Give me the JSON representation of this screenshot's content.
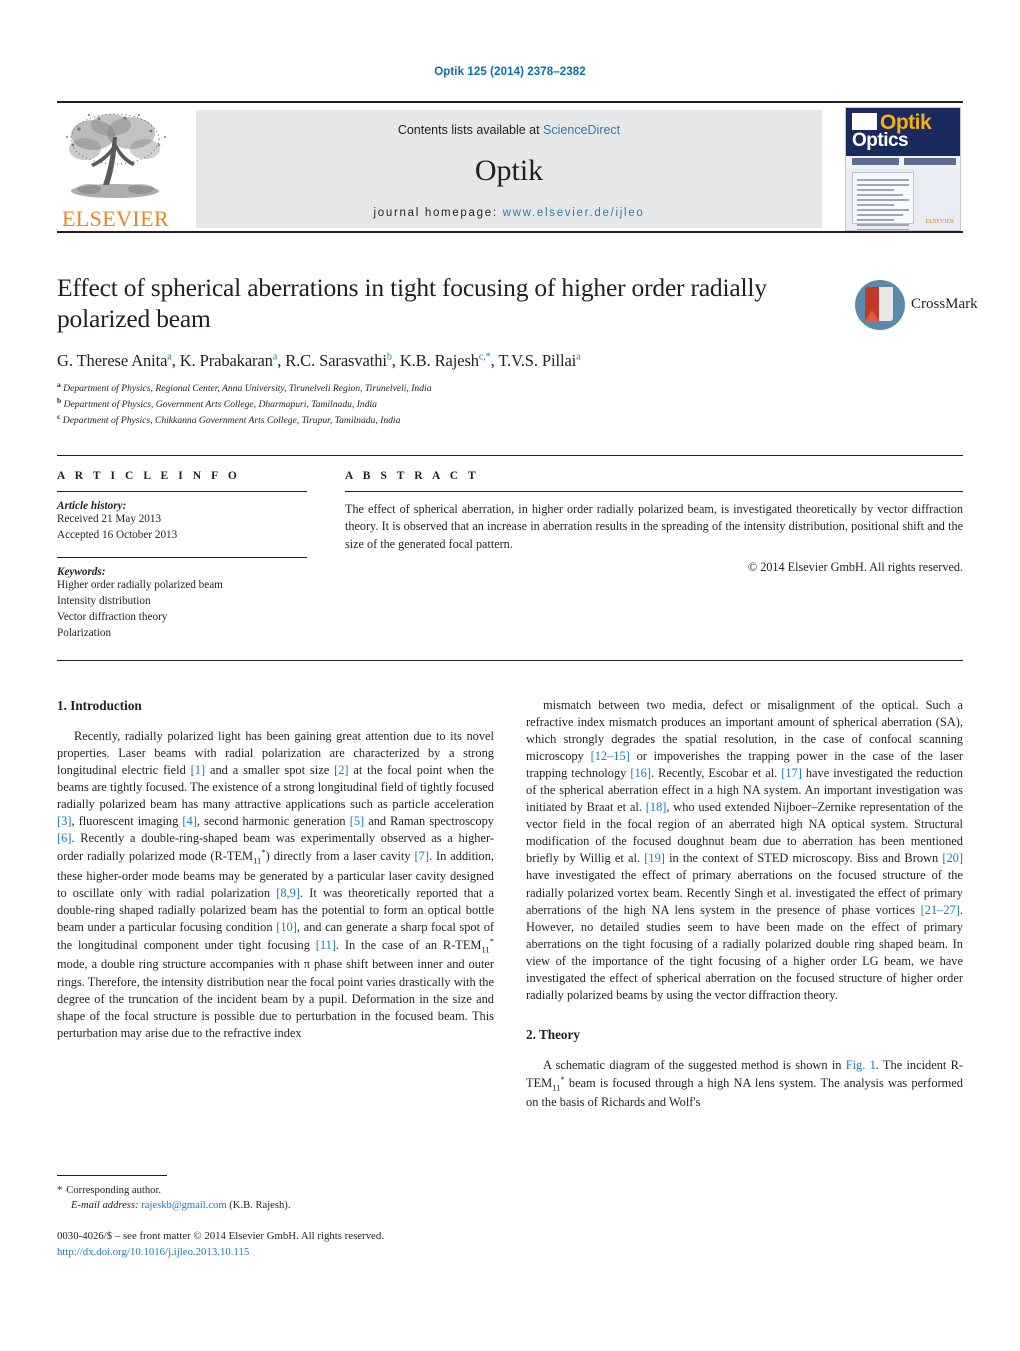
{
  "running_head": "Optik 125 (2014) 2378–2382",
  "masthead": {
    "contents_prefix": "Contents lists available at ",
    "sciencedirect": "ScienceDirect",
    "journal_title": "Optik",
    "homepage_prefix": "journal homepage:",
    "homepage_url": "www.elsevier.de/ijleo",
    "publisher_wordmark": "ELSEVIER",
    "cover": {
      "title_top": "Optik",
      "title_bottom": "Optics",
      "publisher": "ELSEVIER"
    },
    "colors": {
      "link_blue": "#2e7db3",
      "elsevier_orange": "#e8842a",
      "banner_gray": "#e6e7e8",
      "cover_navy": "#1b2a5e",
      "cover_yellow": "#f5b014"
    }
  },
  "article": {
    "title": "Effect of spherical aberrations in tight focusing of higher order radially polarized beam",
    "authors_html": "G. Therese Anita<sup>a</sup>, K. Prabakaran<sup>a</sup>, R.C. Sarasvathi<sup>b</sup>, K.B. Rajesh<sup>c,*</sup>, T.V.S. Pillai<sup>a</sup>",
    "affiliations": [
      {
        "marker": "a",
        "text": "Department of Physics, Regional Center, Anna University, Tirunelveli Region, Tirunelveli, India"
      },
      {
        "marker": "b",
        "text": "Department of Physics, Government Arts College, Dharmapuri, Tamilnadu, India"
      },
      {
        "marker": "c",
        "text": "Department of Physics, Chikkanna Government Arts College, Tirupur, Tamilnadu, India"
      }
    ],
    "crossmark_label": "CrossMark"
  },
  "article_info": {
    "heading": "A R T I C L E    I N F O",
    "history_label": "Article history:",
    "received": "Received 21 May 2013",
    "accepted": "Accepted 16 October 2013",
    "keywords_label": "Keywords:",
    "keywords": [
      "Higher order radially polarized beam",
      "Intensity distribution",
      "Vector diffraction theory",
      "Polarization"
    ]
  },
  "abstract": {
    "heading": "A B S T R A C T",
    "text": "The effect of spherical aberration, in higher order radially polarized beam, is investigated theoretically by vector diffraction theory. It is observed that an increase in aberration results in the spreading of the intensity distribution, positional shift and the size of the generated focal pattern.",
    "copyright": "© 2014 Elsevier GmbH. All rights reserved."
  },
  "body": {
    "intro_heading": "1.  Introduction",
    "intro_html": "Recently, radially polarized light has been gaining great attention due to its novel properties. Laser beams with radial polarization are characterized by a strong longitudinal electric field <span class=\"ref\">[1]</span> and a smaller spot size <span class=\"ref\">[2]</span> at the focal point when the beams are tightly focused. The existence of a strong longitudinal field of tightly focused radially polarized beam has many attractive applications such as particle acceleration <span class=\"ref\">[3]</span>, fluorescent imaging <span class=\"ref\">[4]</span>, second harmonic generation <span class=\"ref\">[5]</span> and Raman spectroscopy <span class=\"ref\">[6]</span>. Recently a double-ring-shaped beam was experimentally observed as a higher-order radially polarized mode (R-TEM<sub>11</sub><sup>*</sup>) directly from a laser cavity <span class=\"ref\">[7]</span>. In addition, these higher-order mode beams may be generated by a particular laser cavity designed to oscillate only with radial polarization <span class=\"ref\">[8,9]</span>. It was theoretically reported that a double-ring shaped radially polarized beam has the potential to form an optical bottle beam under a particular focusing condition <span class=\"ref\">[10]</span>, and can generate a sharp focal spot of the longitudinal component under tight focusing <span class=\"ref\">[11]</span>. In the case of an R-TEM<sub>11</sub><sup>*</sup> mode, a double ring structure accompanies with π phase shift between inner and outer rings. Therefore, the intensity distribution near the focal point varies drastically with the degree of the truncation of the incident beam by a pupil. Deformation in the size and shape of the focal structure is possible due to perturbation in the focused beam. This perturbation may arise due to the refractive index",
    "right_html": "mismatch between two media, defect or misalignment of the optical. Such a refractive index mismatch produces an important amount of spherical aberration (SA), which strongly degrades the spatial resolution, in the case of confocal scanning microscopy <span class=\"ref\">[12–15]</span> or impoverishes the trapping power in the case of the laser trapping technology <span class=\"ref\">[16]</span>. Recently, Escobar et al. <span class=\"ref\">[17]</span> have investigated the reduction of the spherical aberration effect in a high NA system. An important investigation was initiated by Braat et al. <span class=\"ref\">[18]</span>, who used extended Nijboer–Zernike representation of the vector field in the focal region of an aberrated high NA optical system. Structural modification of the focused doughnut beam due to aberration has been mentioned briefly by Willig et al. <span class=\"ref\">[19]</span> in the context of STED microscopy. Biss and Brown <span class=\"ref\">[20]</span> have investigated the effect of primary aberrations on the focused structure of the radially polarized vortex beam. Recently Singh et al. investigated the effect of primary aberrations of the high NA lens system in the presence of phase vortices <span class=\"ref\">[21–27]</span>. However, no detailed studies seem to have been made on the effect of primary aberrations on the tight focusing of a radially polarized double ring shaped beam. In view of the importance of the tight focusing of a higher order LG beam, we have investigated the effect of spherical aberration on the focused structure of higher order radially polarized beams by using the vector diffraction theory.",
    "theory_heading": "2.  Theory",
    "theory_html": "A schematic diagram of the suggested method is shown in <span class=\"ref\">Fig. 1</span>. The incident R-TEM<sub>11</sub><sup>*</sup> beam is focused through a high NA lens system. The analysis was performed on the basis of Richards and Wolf's"
  },
  "footer": {
    "corresponding_star": "*",
    "corresponding_label": "Corresponding author.",
    "email_label": "E-mail address:",
    "email": "rajeskb@gmail.com",
    "email_owner": "(K.B. Rajesh).",
    "imprint": "0030-4026/$ – see front matter © 2014 Elsevier GmbH. All rights reserved.",
    "doi": "http://dx.doi.org/10.1016/j.ijleo.2013.10.115"
  }
}
